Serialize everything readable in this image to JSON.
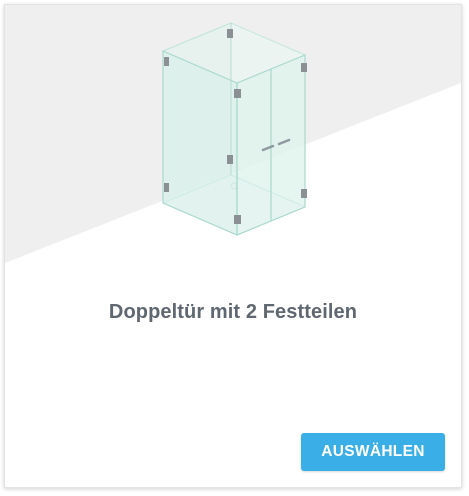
{
  "card": {
    "title": "Doppeltür mit 2 Festteilen",
    "illustration": "glass-shower-double-door-icon",
    "select_label": "AUSWÄHLEN"
  },
  "colors": {
    "accent": "#3aaee6",
    "title_text": "#5f6770",
    "backdrop": "#efefef"
  }
}
